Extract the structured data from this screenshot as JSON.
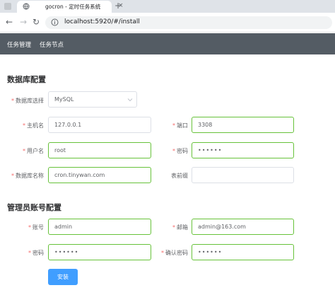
{
  "browser": {
    "tab_title": "gocron - 定时任务系统",
    "url": "localhost:5920/#/install",
    "new_tab_label": "+",
    "close_label": "×"
  },
  "nav": {
    "items": [
      {
        "label": "任务管理"
      },
      {
        "label": "任务节点"
      }
    ]
  },
  "database": {
    "title": "数据库配置",
    "type_label": "数据库选择",
    "type_value": "MySQL",
    "host_label": "主机名",
    "host_value": "127.0.0.1",
    "port_label": "端口",
    "port_value": "3308",
    "user_label": "用户名",
    "user_value": "root",
    "password_label": "密码",
    "password_value": "••••••",
    "name_label": "数据库名称",
    "name_value": "cron.tinywan.com",
    "prefix_label": "表前缀",
    "prefix_value": ""
  },
  "admin": {
    "title": "管理员账号配置",
    "account_label": "账号",
    "account_value": "admin",
    "email_label": "邮箱",
    "email_value": "admin@163.com",
    "password_label": "密码",
    "password_value": "••••••",
    "confirm_label": "确认密码",
    "confirm_value": "••••••"
  },
  "install_button": "安装",
  "required_mark": "*",
  "colors": {
    "nav_bg": "#545c64",
    "primary": "#409eff",
    "success_border": "#67c23a",
    "required": "#f56c6c"
  }
}
